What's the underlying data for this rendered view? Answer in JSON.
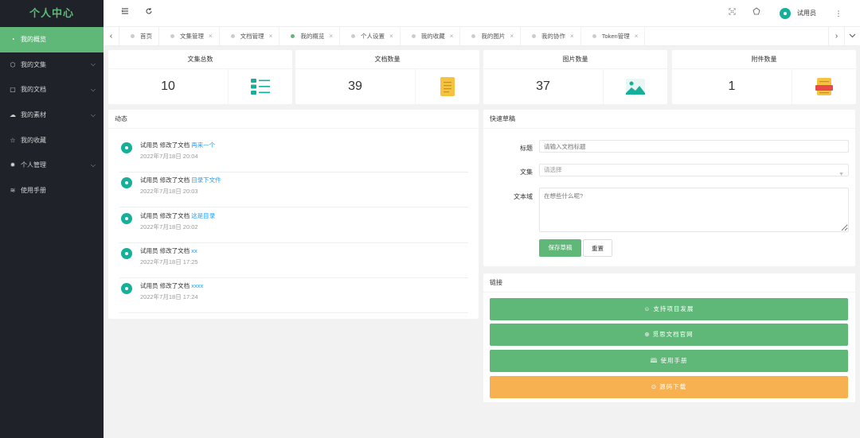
{
  "sidebar": {
    "title": "个人中心",
    "items": [
      {
        "label": "我的概览",
        "icon": "dashboard-icon",
        "glyph": "◔",
        "active": true,
        "has_children": false
      },
      {
        "label": "我的文集",
        "icon": "box-icon",
        "glyph": "⬡",
        "active": false,
        "has_children": true
      },
      {
        "label": "我的文档",
        "icon": "file-icon",
        "glyph": "▢",
        "active": false,
        "has_children": true
      },
      {
        "label": "我的素材",
        "icon": "cloud-icon",
        "glyph": "☁",
        "active": false,
        "has_children": true
      },
      {
        "label": "我的收藏",
        "icon": "star-icon",
        "glyph": "☆",
        "active": false,
        "has_children": false
      },
      {
        "label": "个人管理",
        "icon": "gear-icon",
        "glyph": "✹",
        "active": false,
        "has_children": true
      },
      {
        "label": "使用手册",
        "icon": "layers-icon",
        "glyph": "≋",
        "active": false,
        "has_children": false
      }
    ]
  },
  "header": {
    "menu_icon": "menu-fold-icon",
    "refresh_icon": "refresh-icon",
    "fullscreen_icon": "fullscreen-icon",
    "home_icon": "pentagon-icon",
    "username": "试用员",
    "more_icon": "more-vertical-icon"
  },
  "tabs": [
    {
      "label": "首页",
      "active": false,
      "closable": false
    },
    {
      "label": "文集管理",
      "active": false,
      "closable": true
    },
    {
      "label": "文档管理",
      "active": false,
      "closable": true
    },
    {
      "label": "我的概览",
      "active": true,
      "closable": true
    },
    {
      "label": "个人设置",
      "active": false,
      "closable": true
    },
    {
      "label": "我的收藏",
      "active": false,
      "closable": true
    },
    {
      "label": "我的图片",
      "active": false,
      "closable": true
    },
    {
      "label": "我的协作",
      "active": false,
      "closable": true
    },
    {
      "label": "Token管理",
      "active": false,
      "closable": true
    }
  ],
  "stats": [
    {
      "title": "文集总数",
      "value": "10",
      "icon": "list-icon",
      "color": "#16b09a"
    },
    {
      "title": "文档数量",
      "value": "39",
      "icon": "document-icon",
      "color": "#f5c242"
    },
    {
      "title": "图片数量",
      "value": "37",
      "icon": "image-icon",
      "color": "#16b09a"
    },
    {
      "title": "附件数量",
      "value": "1",
      "icon": "attachment-icon",
      "color": "#f5a623"
    }
  ],
  "activity": {
    "title": "动态",
    "items": [
      {
        "user": "试用员",
        "action": "修改了文档",
        "target": "再来一个",
        "time": "2022年7月18日 20:04"
      },
      {
        "user": "试用员",
        "action": "修改了文档",
        "target": "目录下文件",
        "time": "2022年7月18日 20:03"
      },
      {
        "user": "试用员",
        "action": "修改了文档",
        "target": "这是目录",
        "time": "2022年7月18日 20:02"
      },
      {
        "user": "试用员",
        "action": "修改了文档",
        "target": "xx",
        "time": "2022年7月18日 17:25"
      },
      {
        "user": "试用员",
        "action": "修改了文档",
        "target": "xxxx",
        "time": "2022年7月18日 17:24"
      }
    ]
  },
  "quick_draft": {
    "title": "快速草稿",
    "title_label": "标题",
    "title_placeholder": "请输入文档标题",
    "collection_label": "文集",
    "collection_placeholder": "请选择",
    "content_label": "文本域",
    "content_placeholder": "在想些什么呢?",
    "save_label": "保存草稿",
    "reset_label": "重置"
  },
  "links": {
    "title": "链接",
    "items": [
      {
        "label": "☺ 支持项目发展",
        "icon": "smile-icon",
        "color": "#5fb878"
      },
      {
        "label": "⊕ 觅思文档官网",
        "icon": "globe-icon",
        "color": "#5fb878"
      },
      {
        "label": "🕮 使用手册",
        "icon": "book-icon",
        "color": "#5fb878"
      },
      {
        "label": "⊙ 源码下载",
        "icon": "download-icon",
        "color": "#f7b150"
      }
    ]
  }
}
